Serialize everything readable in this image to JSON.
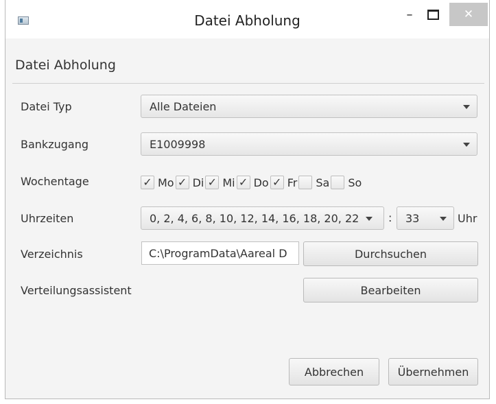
{
  "window": {
    "title": "Datei Abholung",
    "minimize_glyph": "–",
    "close_glyph": "✕"
  },
  "panel": {
    "header": "Datei Abholung"
  },
  "form": {
    "file_type": {
      "label": "Datei Typ",
      "value": "Alle Dateien"
    },
    "bank_access": {
      "label": "Bankzugang",
      "value": "E1009998"
    },
    "weekdays": {
      "label": "Wochentage",
      "days": [
        {
          "label": "Mo",
          "checked": true
        },
        {
          "label": "Di",
          "checked": true
        },
        {
          "label": "Mi",
          "checked": true
        },
        {
          "label": "Do",
          "checked": true
        },
        {
          "label": "Fr",
          "checked": true
        },
        {
          "label": "Sa",
          "checked": false
        },
        {
          "label": "So",
          "checked": false
        }
      ]
    },
    "times": {
      "label": "Uhrzeiten",
      "hours_value": "0, 2, 4, 6, 8, 10, 12, 14, 16, 18, 20, 22",
      "separator": ":",
      "minute_value": "33",
      "unit": "Uhr"
    },
    "directory": {
      "label": "Verzeichnis",
      "value": "C:\\ProgramData\\Aareal D",
      "browse_label": "Durchsuchen"
    },
    "distribution": {
      "label": "Verteilungsassistent",
      "edit_label": "Bearbeiten"
    }
  },
  "footer": {
    "cancel_label": "Abbrechen",
    "apply_label": "Übernehmen"
  },
  "icons": {
    "check": "✓"
  },
  "colors": {
    "close_button": "#c7c7c7",
    "background": "#f4f4f4"
  }
}
